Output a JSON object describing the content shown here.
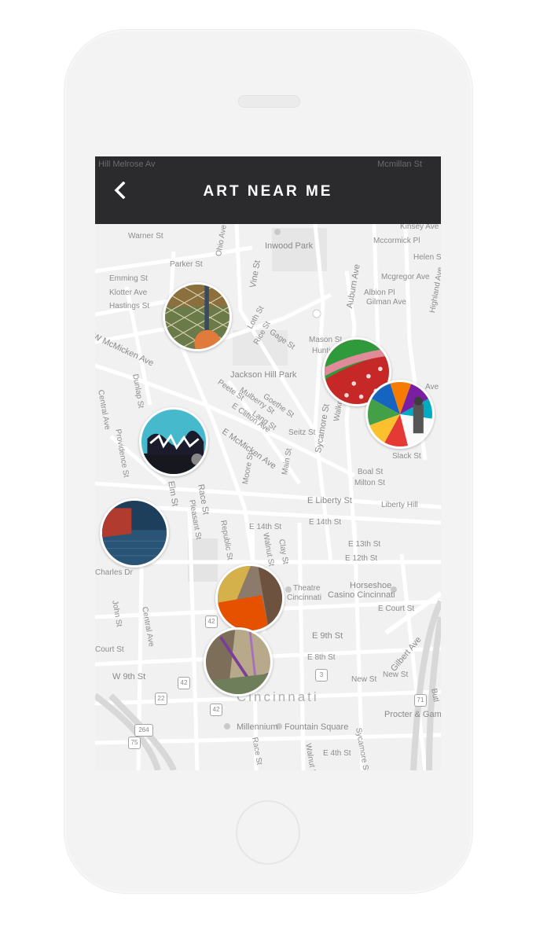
{
  "header": {
    "title": "ART NEAR ME",
    "status_left": "Hill Melrose Av",
    "status_right": "Mcmillan St"
  },
  "map": {
    "labels": {
      "warner": "Warner St",
      "parker": "Parker St",
      "emming": "Emming St",
      "klotter": "Klotter Ave",
      "hastings": "Hastings St",
      "mcmicken_w": "W McMicken Ave",
      "dunlap": "Dunlap St",
      "central": "Central Ave",
      "providence": "Providence St",
      "vine": "Vine St",
      "ohio": "Ohio Ave",
      "inwood": "Inwood Park",
      "loth": "Loth St",
      "rice": "Rice St",
      "gage": "Gage St",
      "jackson": "Jackson Hill Park",
      "peete": "Peete St",
      "mulberry": "Mulberry St",
      "goethe": "Goethe St",
      "clifton": "E Clifton Ave",
      "lang": "Lang St",
      "seitz": "Seitz St",
      "mcmicken_e": "E McMicken Ave",
      "moore": "Moore St",
      "main": "Main St",
      "mason": "Mason St",
      "huntington": "Huntington",
      "sycamore": "Sycamore St",
      "walker": "Walker St",
      "auburn": "Auburn Ave",
      "albion": "Albion Pl",
      "gilman": "Gilman Ave",
      "mcgregor": "Mcgregor Ave",
      "mccormick": "Mccormick Pl",
      "helen": "Helen St",
      "kinsey": "Kinsey Ave",
      "highland": "Highland Ave",
      "ave": "Ave",
      "slack": "Slack St",
      "boal": "Boal St",
      "milton": "Milton St",
      "liberty": "E Liberty St",
      "liberty_hill": "Liberty Hill",
      "elm": "Elm St",
      "race": "Race St",
      "pleasant": "Pleasant St",
      "republic": "Republic St",
      "e14th": "E 14th St",
      "e14th_2": "E 14th St",
      "e13th": "E 13th St",
      "e12th": "E 12th St",
      "walnut": "Walnut St",
      "clay": "Clay St",
      "charles": "Charles Dr",
      "john": "John St",
      "central2": "Central Ave",
      "theatre": "Theatre",
      "cincinnati_small": "Cincinnati",
      "horseshoe": "Horseshoe",
      "casino": "Casino Cincinnati",
      "ecourt": "E Court St",
      "court": "Court St",
      "e9th": "E 9th St",
      "e8th": "E 8th St",
      "w9th": "W 9th St",
      "new": "New St",
      "new2": "New St",
      "gilbert": "Gilbert Ave",
      "city": "Cincinnati",
      "millennium": "Millennium",
      "fountain": "Fountain Square",
      "race2": "Race St",
      "walnut2": "Walnut St",
      "sycamore2": "Sycamore St",
      "e4th": "E 4th St",
      "procter": "Procter & Gamble",
      "buttler": "Butl",
      "shield_42": "42",
      "shield_42b": "42",
      "shield_42c": "42",
      "shield_22": "22",
      "shield_3": "3",
      "shield_264": "264",
      "shield_75": "75",
      "shield_71": "71"
    },
    "pins": [
      {
        "name": "fence-artwork",
        "palette": [
          "#5a6b3a",
          "#c99a4f",
          "#e07040"
        ]
      },
      {
        "name": "graffiti-artwork",
        "palette": [
          "#4fc3d7",
          "#1b1b2b",
          "#ffffff"
        ]
      },
      {
        "name": "brick-mural-artwork",
        "palette": [
          "#1f4a6b",
          "#c0392b",
          "#5b7fa3"
        ]
      },
      {
        "name": "polka-dot-artwork",
        "palette": [
          "#c62828",
          "#2e9a3b",
          "#f7d9d9"
        ]
      },
      {
        "name": "geometric-mural-artwork",
        "palette": [
          "#1565c0",
          "#f57c00",
          "#7b1fa2"
        ]
      },
      {
        "name": "orange-patch-artwork",
        "palette": [
          "#e65100",
          "#fbc02d",
          "#795548"
        ]
      },
      {
        "name": "purple-line-artwork",
        "palette": [
          "#7b5a8a",
          "#c9b89a",
          "#6e7d5a"
        ]
      }
    ]
  }
}
